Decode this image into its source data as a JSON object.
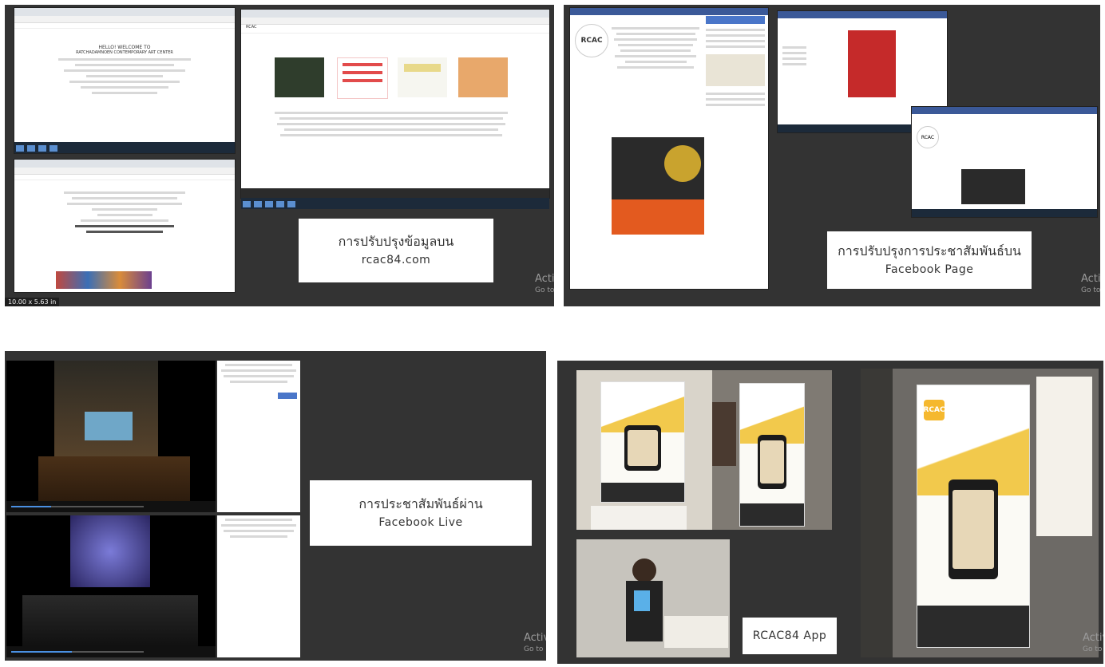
{
  "panels": {
    "website": {
      "caption_line1": "การปรับปรุงข้อมูลบน",
      "caption_line2": "rcac84.com",
      "size_label": "10.00 x 5.63 in",
      "welcome": "HELLO! WELCOME TO",
      "welcome2": "RATCHADAMNOEN CONTEMPORARY ART CENTER",
      "brand": "RCAC",
      "activation_line1": "Acti",
      "activation_line2": "Go to"
    },
    "facebook_page": {
      "caption_line1": "การปรับปรุงการประชาสัมพันธ์บน",
      "caption_line2": "Facebook Page",
      "brand": "RCAC",
      "activation_line1": "Activ",
      "activation_line2": "Go to"
    },
    "facebook_live": {
      "caption_line1": "การประชาสัมพันธ์ผ่าน",
      "caption_line2": "Facebook Live",
      "activation_line1": "Activ",
      "activation_line2": "Go to"
    },
    "app": {
      "caption": "RCAC84 App",
      "brand": "RCAC",
      "activation_line1": "Activ",
      "activation_line2": "Go to"
    }
  },
  "colors": {
    "panel_bg": "#333333",
    "facebook_blue": "#3b5998",
    "app_yellow": "#f5b82e"
  }
}
